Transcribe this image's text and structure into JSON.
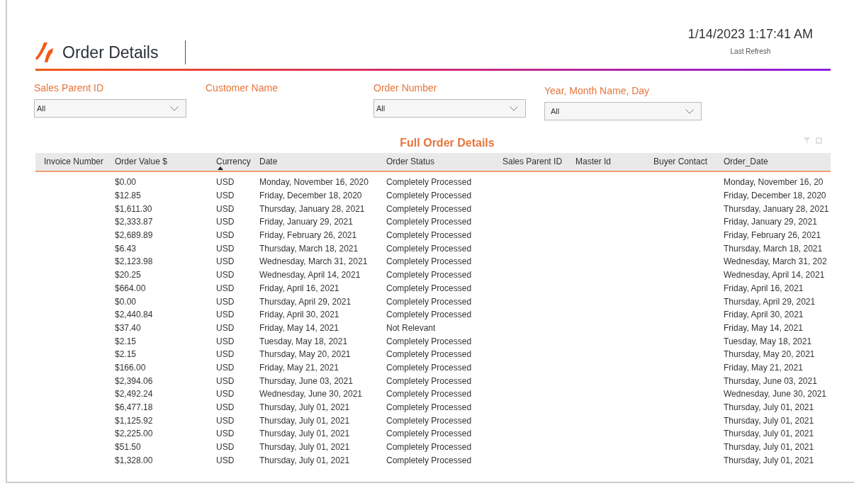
{
  "header": {
    "title": "Order Details",
    "refresh_time": "1/14/2023 1:17:41 AM",
    "refresh_label": "Last Refresh"
  },
  "filters": [
    {
      "label": "Sales Parent ID",
      "kind": "dropdown",
      "value": "All"
    },
    {
      "label": "Customer Name",
      "kind": "label"
    },
    {
      "label": "Order Number",
      "kind": "dropdown",
      "value": "All"
    },
    {
      "label": "Year, Month Name, Day",
      "kind": "dropdown",
      "value": "All"
    }
  ],
  "table": {
    "title": "Full Order Details",
    "columns": [
      {
        "label": "Invoice Number",
        "sorted": false
      },
      {
        "label": "Order Value $",
        "sorted": false
      },
      {
        "label": "Currency",
        "sorted": true
      },
      {
        "label": "Date",
        "sorted": false
      },
      {
        "label": "Order Status",
        "sorted": false
      },
      {
        "label": "Sales Parent ID",
        "sorted": false
      },
      {
        "label": "Master Id",
        "sorted": false
      },
      {
        "label": "Buyer Contact",
        "sorted": false
      },
      {
        "label": "Order_Date",
        "sorted": false
      }
    ],
    "rows": [
      {
        "order_value": "$0.00",
        "currency": "USD",
        "date": "Monday, November 16, 2020",
        "status": "Completely Processed",
        "order_date": "Monday, November 16, 20"
      },
      {
        "order_value": "$12.85",
        "currency": "USD",
        "date": "Friday, December 18, 2020",
        "status": "Completely Processed",
        "order_date": "Friday, December 18, 2020"
      },
      {
        "order_value": "$1,611.30",
        "currency": "USD",
        "date": "Thursday, January 28, 2021",
        "status": "Completely Processed",
        "order_date": "Thursday, January 28, 2021"
      },
      {
        "order_value": "$2,333.87",
        "currency": "USD",
        "date": "Friday, January 29, 2021",
        "status": "Completely Processed",
        "order_date": "Friday, January 29, 2021"
      },
      {
        "order_value": "$2,689.89",
        "currency": "USD",
        "date": "Friday, February 26, 2021",
        "status": "Completely Processed",
        "order_date": "Friday, February 26, 2021"
      },
      {
        "order_value": "$6.43",
        "currency": "USD",
        "date": "Thursday, March 18, 2021",
        "status": "Completely Processed",
        "order_date": "Thursday, March 18, 2021"
      },
      {
        "order_value": "$2,123.98",
        "currency": "USD",
        "date": "Wednesday, March 31, 2021",
        "status": "Completely Processed",
        "order_date": "Wednesday, March 31, 202"
      },
      {
        "order_value": "$20.25",
        "currency": "USD",
        "date": "Wednesday, April 14, 2021",
        "status": "Completely Processed",
        "order_date": "Wednesday, April 14, 2021"
      },
      {
        "order_value": "$664.00",
        "currency": "USD",
        "date": "Friday, April 16, 2021",
        "status": "Completely Processed",
        "order_date": "Friday, April 16, 2021"
      },
      {
        "order_value": "$0.00",
        "currency": "USD",
        "date": "Thursday, April 29, 2021",
        "status": "Completely Processed",
        "order_date": "Thursday, April 29, 2021"
      },
      {
        "order_value": "$2,440.84",
        "currency": "USD",
        "date": "Friday, April 30, 2021",
        "status": "Completely Processed",
        "order_date": "Friday, April 30, 2021"
      },
      {
        "order_value": "$37.40",
        "currency": "USD",
        "date": "Friday, May 14, 2021",
        "status": "Not Relevant",
        "order_date": "Friday, May 14, 2021"
      },
      {
        "order_value": "$2.15",
        "currency": "USD",
        "date": "Tuesday, May 18, 2021",
        "status": "Completely Processed",
        "order_date": "Tuesday, May 18, 2021"
      },
      {
        "order_value": "$2.15",
        "currency": "USD",
        "date": "Thursday, May 20, 2021",
        "status": "Completely Processed",
        "order_date": "Thursday, May 20, 2021"
      },
      {
        "order_value": "$166.00",
        "currency": "USD",
        "date": "Friday, May 21, 2021",
        "status": "Completely Processed",
        "order_date": "Friday, May 21, 2021"
      },
      {
        "order_value": "$2,394.06",
        "currency": "USD",
        "date": "Thursday, June 03, 2021",
        "status": "Completely Processed",
        "order_date": "Thursday, June 03, 2021"
      },
      {
        "order_value": "$2,492.24",
        "currency": "USD",
        "date": "Wednesday, June 30, 2021",
        "status": "Completely Processed",
        "order_date": "Wednesday, June 30, 2021"
      },
      {
        "order_value": "$6,477.18",
        "currency": "USD",
        "date": "Thursday, July 01, 2021",
        "status": "Completely Processed",
        "order_date": "Thursday, July 01, 2021"
      },
      {
        "order_value": "$1,125.92",
        "currency": "USD",
        "date": "Thursday, July 01, 2021",
        "status": "Completely Processed",
        "order_date": "Thursday, July 01, 2021"
      },
      {
        "order_value": "$2,225.00",
        "currency": "USD",
        "date": "Thursday, July 01, 2021",
        "status": "Completely Processed",
        "order_date": "Thursday, July 01, 2021"
      },
      {
        "order_value": "$51.50",
        "currency": "USD",
        "date": "Thursday, July 01, 2021",
        "status": "Completely Processed",
        "order_date": "Thursday, July 01, 2021"
      },
      {
        "order_value": "$1,328.00",
        "currency": "USD",
        "date": "Thursday, July 01, 2021",
        "status": "Completely Processed",
        "order_date": "Thursday, July 01, 2021"
      }
    ]
  }
}
